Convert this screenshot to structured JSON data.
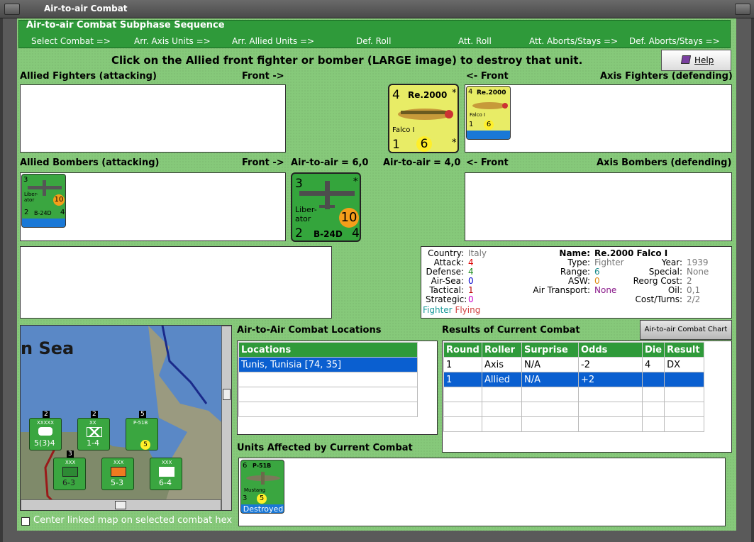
{
  "window": {
    "title": "Air-to-air Combat"
  },
  "phase": {
    "title": "Air-to-air Combat Subphase Sequence",
    "steps": [
      "Select Combat =>",
      "Arr. Axis Units =>",
      "Arr. Allied Units =>",
      "Def. Roll",
      "Att. Roll",
      "Att. Aborts/Stays =>",
      "Def. Aborts/Stays =>"
    ]
  },
  "instruction": "Click on the Allied front fighter or bomber (LARGE image) to destroy that unit.",
  "help_label": "Help",
  "labels": {
    "allied_fighters": "Allied Fighters (attacking)",
    "front_right": "Front ->",
    "front_left": "<- Front",
    "axis_fighters": "Axis Fighters (defending)",
    "allied_bombers": "Allied Bombers (attacking)",
    "air_allied": "Air-to-air = 6,0",
    "air_axis": "Air-to-air = 4,0",
    "axis_bombers": "Axis Bombers (defending)"
  },
  "axis_fighter": {
    "attack": "4",
    "name": "Re.2000",
    "subname": "Falco I",
    "range": "1",
    "defense": "6",
    "star": "*"
  },
  "allied_bomber": {
    "attack": "3",
    "name": "Liber-ator",
    "model": "B-24D",
    "range": "2",
    "defense": "4",
    "strat": "10",
    "star": "*"
  },
  "info": {
    "country_k": "Country:",
    "country": "Italy",
    "attack_k": "Attack:",
    "attack": "4",
    "defense_k": "Defense:",
    "defense": "4",
    "airsea_k": "Air-Sea:",
    "airsea": "0",
    "tactical_k": "Tactical:",
    "tactical": "1",
    "strategic_k": "Strategic:",
    "strategic": "0",
    "cat1": "Fighter",
    "cat2": "Flying",
    "name_k": "Name:",
    "name": "Re.2000 Falco I",
    "type_k": "Type:",
    "type": "Fighter",
    "range_k": "Range:",
    "range": "6",
    "asw_k": "ASW:",
    "asw": "0",
    "transport_k": "Air Transport:",
    "transport": "None",
    "year_k": "Year:",
    "year": "1939",
    "special_k": "Special:",
    "special": "None",
    "reorg_k": "Reorg Cost:",
    "reorg": "2",
    "oil_k": "Oil:",
    "oil": "0,1",
    "costturns_k": "Cost/Turns:",
    "costturns": "2/2"
  },
  "map": {
    "sea_label": "n Sea"
  },
  "locations": {
    "title": "Air-to-Air Combat Locations",
    "header": "Locations",
    "rows": [
      "Tunis, Tunisia [74, 35]"
    ]
  },
  "results": {
    "title": "Results of Current Combat",
    "chart_button": "Air-to-air Combat Chart",
    "headers": [
      "Round",
      "Roller",
      "Surprise",
      "Odds",
      "Die",
      "Result"
    ],
    "rows": [
      [
        "1",
        "Axis",
        "N/A",
        "-2",
        "4",
        "DX"
      ],
      [
        "1",
        "Allied",
        "N/A",
        "+2",
        "",
        ""
      ]
    ]
  },
  "affected": {
    "title": "Units Affected by Current Combat",
    "unit_name": "P-51B",
    "unit_sub": "Mustang",
    "unit_top": "6",
    "unit_bottom": "3",
    "unit_def": "5",
    "status": "Destroyed"
  },
  "checkbox_label": "Center linked map on selected combat hex",
  "map_units": [
    {
      "top": "XXXXX",
      "val": "5(3)4",
      "stack": "2"
    },
    {
      "top": "XX",
      "val": "1-4",
      "stack": "2"
    },
    {
      "top": "P-51B",
      "val": "5",
      "stack": "5"
    },
    {
      "top": "XXX",
      "val": "6-3",
      "stack": "3"
    },
    {
      "top": "XXX",
      "val": "5-3",
      "stack": ""
    },
    {
      "top": "XXX",
      "val": "6-4",
      "stack": ""
    }
  ],
  "colors": {
    "panel_green": "#86c97a",
    "header_green": "#2f9a3a",
    "select_blue": "#0a5fd0"
  }
}
